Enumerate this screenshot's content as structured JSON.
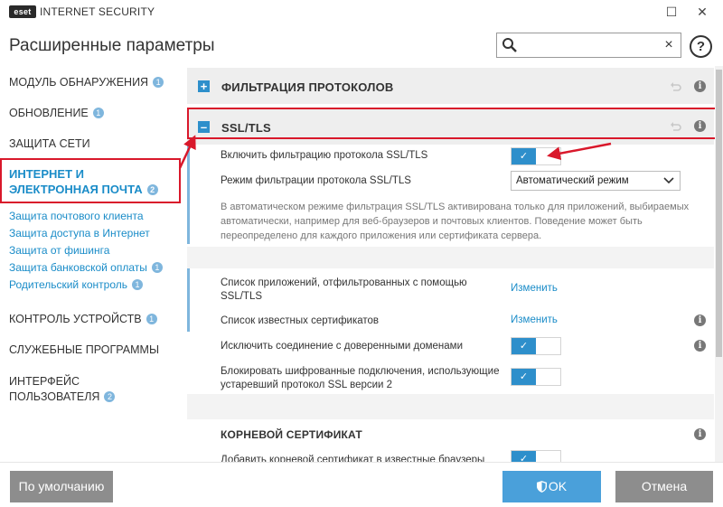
{
  "window": {
    "logo_text": "eset",
    "app_name": "INTERNET SECURITY",
    "minimize": "☐",
    "close": "✕"
  },
  "header": {
    "title": "Расширенные параметры",
    "search_value": "",
    "clear": "×",
    "help": "?"
  },
  "sidebar": {
    "items": [
      {
        "label": "МОДУЛЬ ОБНАРУЖЕНИЯ",
        "badge": "1"
      },
      {
        "label": "ОБНОВЛЕНИЕ",
        "badge": "1"
      },
      {
        "label": "ЗАЩИТА СЕТИ",
        "badge": ""
      },
      {
        "label": "ИНТЕРНЕТ И ЭЛЕКТРОННАЯ ПОЧТА",
        "badge": "2"
      },
      {
        "label": "КОНТРОЛЬ УСТРОЙСТВ",
        "badge": "1"
      },
      {
        "label": "СЛУЖЕБНЫЕ ПРОГРАММЫ",
        "badge": ""
      },
      {
        "label": "ИНТЕРФЕЙС ПОЛЬЗОВАТЕЛЯ",
        "badge": "2"
      }
    ],
    "subitems": [
      {
        "label": "Защита почтового клиента",
        "badge": ""
      },
      {
        "label": "Защита доступа в Интернет",
        "badge": ""
      },
      {
        "label": "Защита от фишинга",
        "badge": ""
      },
      {
        "label": "Защита банковской оплаты",
        "badge": "1"
      },
      {
        "label": "Родительский контроль",
        "badge": "1"
      }
    ]
  },
  "main": {
    "section1": {
      "expand": "+",
      "title": "ФИЛЬТРАЦИЯ ПРОТОКОЛОВ"
    },
    "section2": {
      "expand": "–",
      "title": "SSL/TLS"
    },
    "info": "i",
    "enable_ssl": {
      "label": "Включить фильтрацию протокола SSL/TLS",
      "on": true,
      "check": "✓"
    },
    "mode": {
      "label": "Режим фильтрации протокола SSL/TLS",
      "value": "Автоматический режим"
    },
    "description": "В автоматическом режиме фильтрация SSL/TLS активирована только для приложений, выбираемых автоматически, например для веб-браузеров и почтовых клиентов. Поведение может быть переопределено для каждого приложения или сертификата сервера.",
    "app_list": {
      "label": "Список приложений, отфильтрованных с помощью SSL/TLS",
      "link": "Изменить"
    },
    "cert_list": {
      "label": "Список известных сертификатов",
      "link": "Изменить"
    },
    "exclude_trusted": {
      "label": "Исключить соединение с доверенными доменами",
      "on": true,
      "check": "✓"
    },
    "block_ssl2": {
      "label": "Блокировать шифрованные подключения, использующие устаревший протокол SSL версии 2",
      "on": true,
      "check": "✓"
    },
    "root_cert": {
      "title": "КОРНЕВОЙ СЕРТИФИКАТ"
    },
    "add_root": {
      "label": "Добавить корневой сертификат в известные браузеры",
      "on": true,
      "check": "✓"
    }
  },
  "footer": {
    "default_label": "По умолчанию",
    "ok_label": "OK",
    "cancel_label": "Отмена"
  },
  "colors": {
    "accent": "#2e8fcb",
    "link": "#1a8cc8",
    "highlight": "#d9182b",
    "button_gray": "#8d8d8d",
    "ok_blue": "#4aa0da"
  }
}
